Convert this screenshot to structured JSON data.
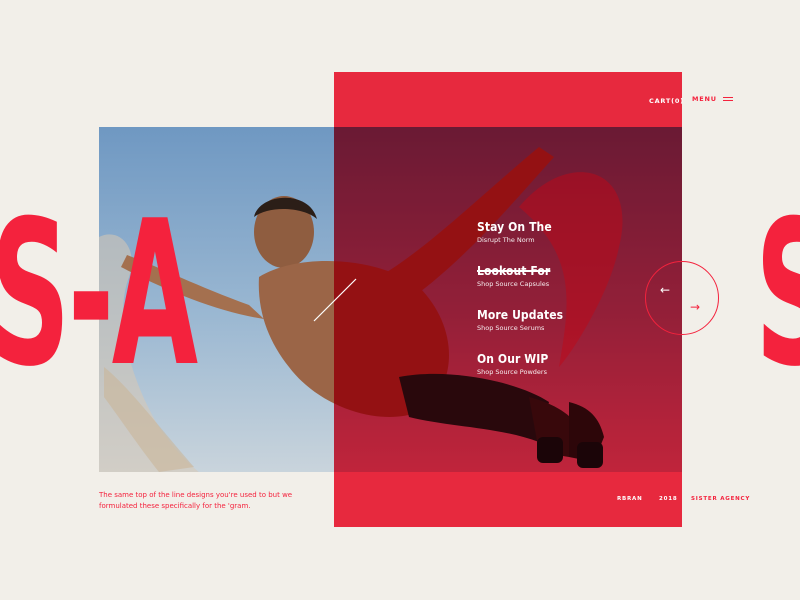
{
  "brand_letters": {
    "left": "S-A",
    "right": "S"
  },
  "header": {
    "cart": "CART(0)",
    "menu": "MENU",
    "menu_icon": "hamburger-icon"
  },
  "nav": [
    {
      "title": "Stay On The",
      "subtitle": "Disrupt The Norm",
      "struck": false
    },
    {
      "title": "Lookout For",
      "subtitle": "Shop Source Capsules",
      "struck": true
    },
    {
      "title": "More Updates",
      "subtitle": "Shop Source Serums",
      "struck": false
    },
    {
      "title": "On Our WIP",
      "subtitle": "Shop Source Powders",
      "struck": false
    }
  ],
  "carousel": {
    "prev_icon": "arrow-left-icon",
    "next_icon": "arrow-right-icon",
    "prev_glyph": "←",
    "next_glyph": "→"
  },
  "tagline": "The same top of the line designs you're used to but we formulated these specifically for the 'gram.",
  "footer": {
    "handle": "RBRAN",
    "year": "2018",
    "agency": "SISTER AGENCY"
  },
  "colors": {
    "accent": "#f4223d",
    "background": "#f2efe9",
    "sky": "#8fb0cf"
  }
}
